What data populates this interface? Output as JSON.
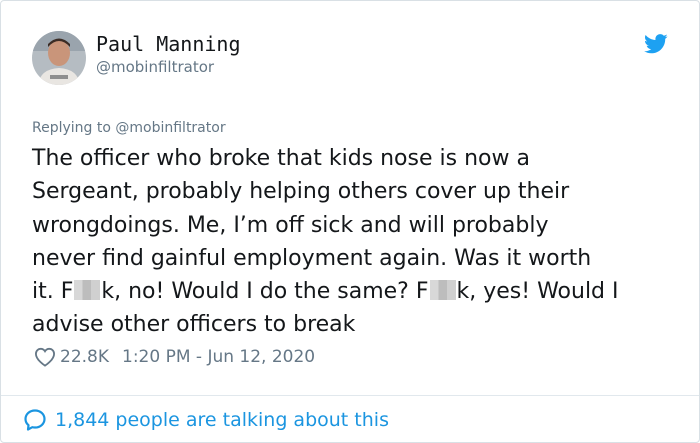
{
  "author": {
    "name": "Paul Manning",
    "handle": "@mobinfiltrator",
    "avatar_icon": "profile-photo"
  },
  "reply_context": "Replying to @mobinfiltrator",
  "tweet": {
    "lines": [
      "The officer who broke that kids nose is now a",
      "Sergeant, probably helping others cover up their",
      "wrongdoings. Me, I’m off sick and will probably",
      "never find gainful employment again. Was it worth"
    ],
    "line5_a": "it. F",
    "line5_b": "k, no! Would I do the same? F",
    "line5_c": "k, yes! Would I",
    "line6": "advise other officers to break"
  },
  "meta": {
    "likes": "22.8K",
    "timestamp": "1:20 PM - Jun 12, 2020"
  },
  "footer": {
    "talking": "1,844 people are talking about this"
  },
  "colors": {
    "text": "#14171a",
    "muted": "#657786",
    "accent": "#1da1f2",
    "link": "#1b95e0",
    "border": "#d9e0e5"
  },
  "icons": [
    "twitter-bird-icon",
    "heart-icon",
    "comment-bubble-icon"
  ]
}
